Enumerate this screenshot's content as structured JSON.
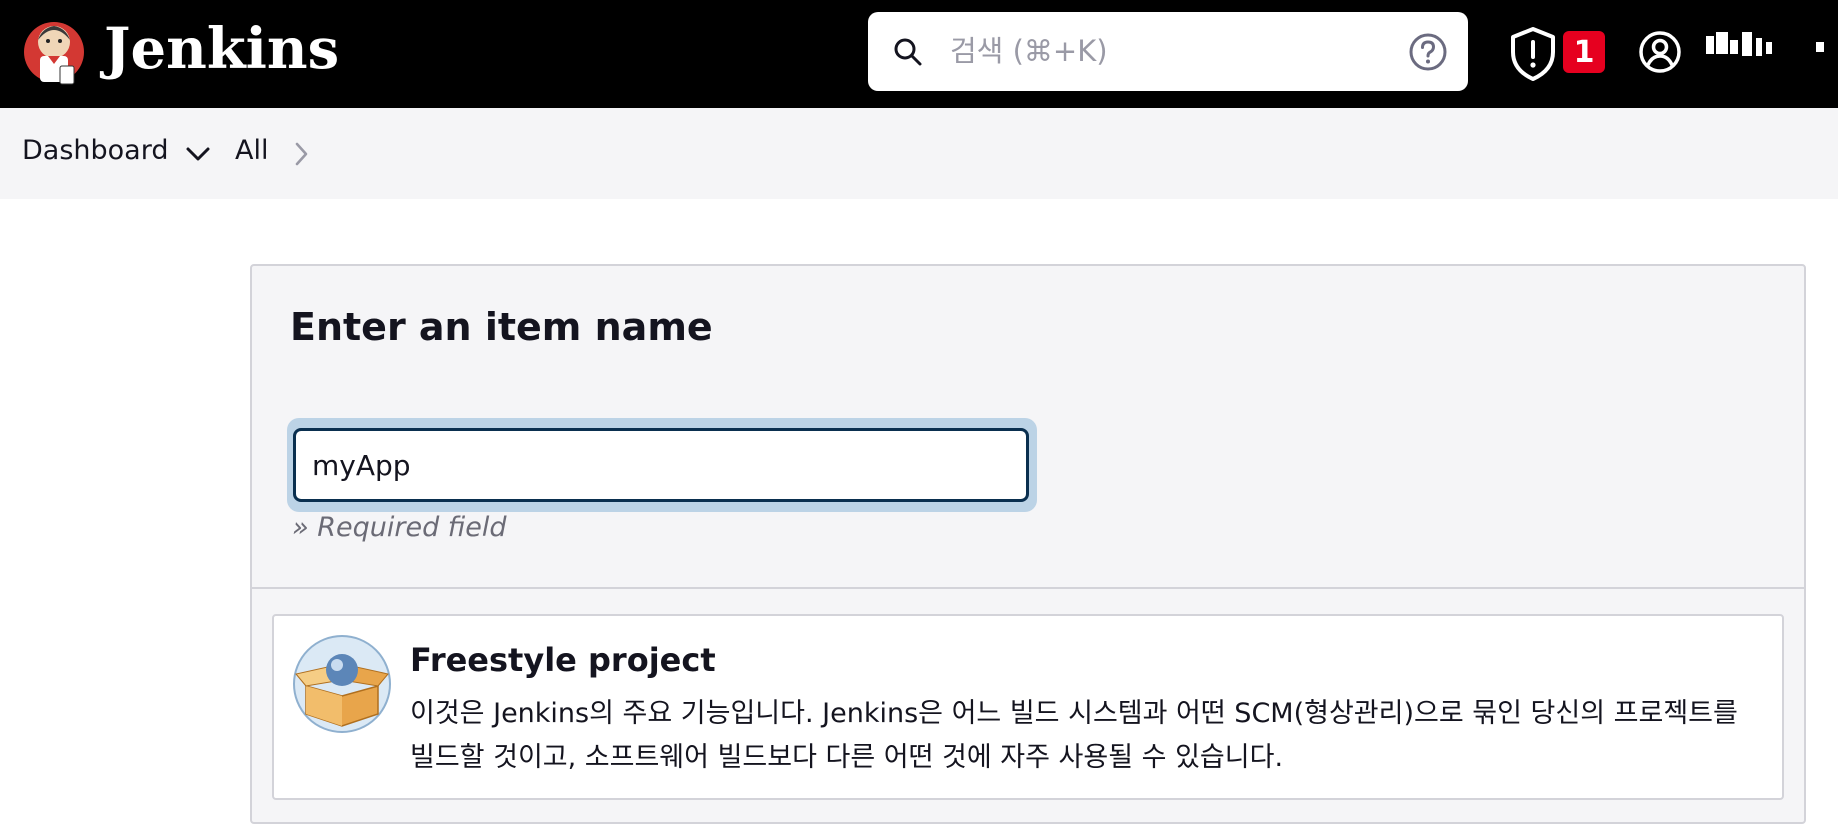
{
  "header": {
    "brand": "Jenkins",
    "search": {
      "placeholder": "검색 (⌘+K)",
      "value": ""
    },
    "alert_count": "1",
    "colors": {
      "background": "#000000",
      "badge": "#e6001f"
    },
    "icons": [
      "jenkins-logo",
      "search-icon",
      "help-icon",
      "shield-alert-icon",
      "user-icon"
    ]
  },
  "breadcrumb": {
    "items": [
      "Dashboard",
      "All"
    ]
  },
  "main": {
    "title": "Enter an item name",
    "name_field": {
      "value": "myApp"
    },
    "required_note": "» Required field",
    "item_types": [
      {
        "title": "Freestyle project",
        "description": "이것은 Jenkins의 주요 기능입니다. Jenkins은 어느 빌드 시스템과 어떤 SCM(형상관리)으로 묶인 당신의 프로젝트를 빌드할 것이고, 소프트웨어 빌드보다 다른 어떤 것에 자주 사용될 수 있습니다.",
        "icon": "freestyle-box-icon"
      }
    ]
  }
}
